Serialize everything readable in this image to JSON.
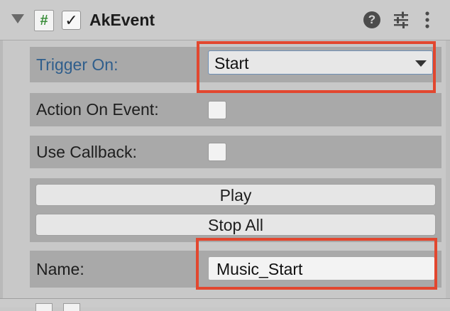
{
  "component": {
    "title": "AkEvent",
    "script_icon_glyph": "#",
    "enabled_glyph": "✓",
    "help_glyph": "?",
    "icons": [
      "foldout-arrow-icon",
      "script-icon",
      "help-icon",
      "presets-icon",
      "more-menu-icon"
    ]
  },
  "fields": {
    "trigger_on": {
      "label": "Trigger On:",
      "value": "Start"
    },
    "action_on_event": {
      "label": "Action On Event:",
      "checked": false
    },
    "use_callback": {
      "label": "Use Callback:",
      "checked": false
    },
    "name": {
      "label": "Name:",
      "value": "Music_Start"
    }
  },
  "buttons": {
    "play": "Play",
    "stop_all": "Stop All"
  },
  "colors": {
    "annotation_highlight": "#e2472f",
    "label_focus": "#2f5e8c",
    "script_icon_green": "#3b8e3b"
  }
}
